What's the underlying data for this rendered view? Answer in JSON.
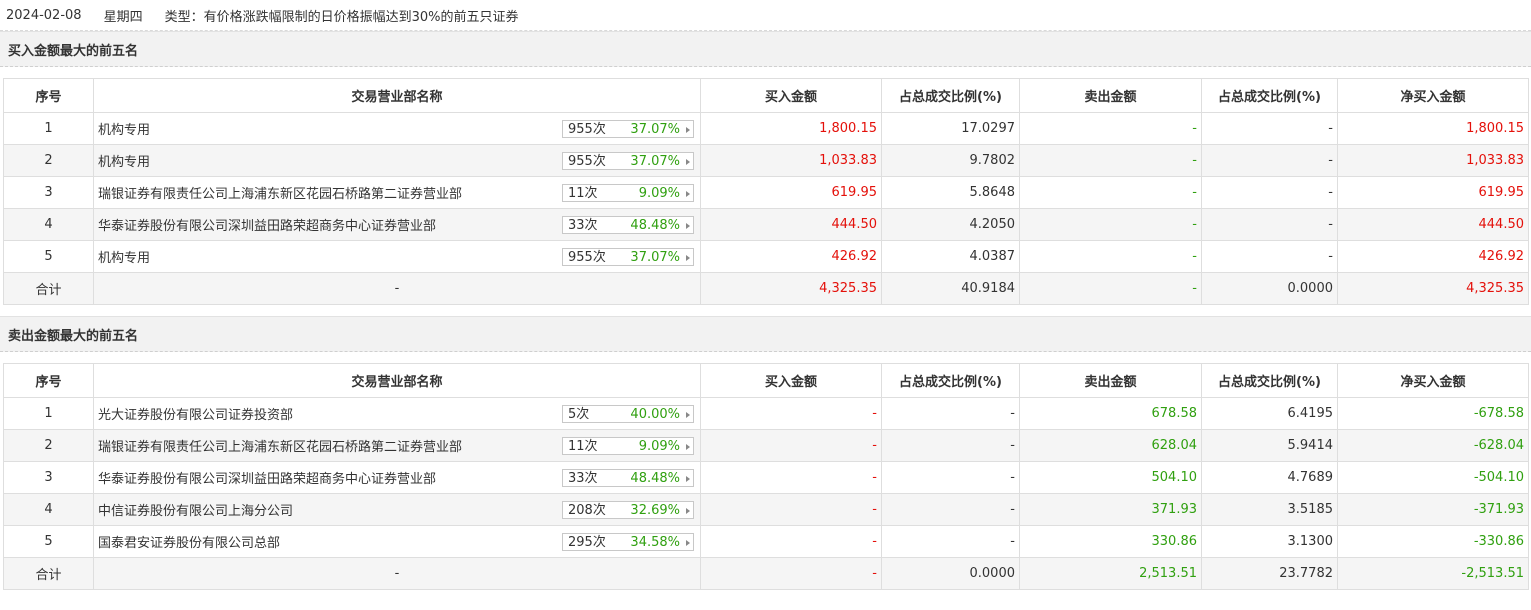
{
  "header": {
    "date": "2024-02-08",
    "weekday": "星期四",
    "type": "类型：有价格涨跌幅限制的日价格振幅达到30%的前五只证券"
  },
  "columns": [
    "序号",
    "交易营业部名称",
    "买入金额",
    "占总成交比例(%)",
    "卖出金额",
    "占总成交比例(%)",
    "净买入金额"
  ],
  "buy_section": {
    "title": "买入金额最大的前五名",
    "rows": [
      {
        "no": "1",
        "name": "机构专用",
        "times": "955次",
        "rate": "37.07%",
        "buy": "1,800.15",
        "buy_pct": "17.0297",
        "sell": "-",
        "sell_pct": "-",
        "net": "1,800.15"
      },
      {
        "no": "2",
        "name": "机构专用",
        "times": "955次",
        "rate": "37.07%",
        "buy": "1,033.83",
        "buy_pct": "9.7802",
        "sell": "-",
        "sell_pct": "-",
        "net": "1,033.83"
      },
      {
        "no": "3",
        "name": "瑞银证券有限责任公司上海浦东新区花园石桥路第二证券营业部",
        "times": "11次",
        "rate": "9.09%",
        "buy": "619.95",
        "buy_pct": "5.8648",
        "sell": "-",
        "sell_pct": "-",
        "net": "619.95"
      },
      {
        "no": "4",
        "name": "华泰证券股份有限公司深圳益田路荣超商务中心证券营业部",
        "times": "33次",
        "rate": "48.48%",
        "buy": "444.50",
        "buy_pct": "4.2050",
        "sell": "-",
        "sell_pct": "-",
        "net": "444.50"
      },
      {
        "no": "5",
        "name": "机构专用",
        "times": "955次",
        "rate": "37.07%",
        "buy": "426.92",
        "buy_pct": "4.0387",
        "sell": "-",
        "sell_pct": "-",
        "net": "426.92"
      }
    ],
    "total": {
      "label": "合计",
      "name": "-",
      "buy": "4,325.35",
      "buy_pct": "40.9184",
      "sell": "-",
      "sell_pct": "0.0000",
      "net": "4,325.35"
    }
  },
  "sell_section": {
    "title": "卖出金额最大的前五名",
    "rows": [
      {
        "no": "1",
        "name": "光大证券股份有限公司证券投资部",
        "times": "5次",
        "rate": "40.00%",
        "buy": "-",
        "buy_pct": "-",
        "sell": "678.58",
        "sell_pct": "6.4195",
        "net": "-678.58"
      },
      {
        "no": "2",
        "name": "瑞银证券有限责任公司上海浦东新区花园石桥路第二证券营业部",
        "times": "11次",
        "rate": "9.09%",
        "buy": "-",
        "buy_pct": "-",
        "sell": "628.04",
        "sell_pct": "5.9414",
        "net": "-628.04"
      },
      {
        "no": "3",
        "name": "华泰证券股份有限公司深圳益田路荣超商务中心证券营业部",
        "times": "33次",
        "rate": "48.48%",
        "buy": "-",
        "buy_pct": "-",
        "sell": "504.10",
        "sell_pct": "4.7689",
        "net": "-504.10"
      },
      {
        "no": "4",
        "name": "中信证券股份有限公司上海分公司",
        "times": "208次",
        "rate": "32.69%",
        "buy": "-",
        "buy_pct": "-",
        "sell": "371.93",
        "sell_pct": "3.5185",
        "net": "-371.93"
      },
      {
        "no": "5",
        "name": "国泰君安证券股份有限公司总部",
        "times": "295次",
        "rate": "34.58%",
        "buy": "-",
        "buy_pct": "-",
        "sell": "330.86",
        "sell_pct": "3.1300",
        "net": "-330.86"
      }
    ],
    "total": {
      "label": "合计",
      "name": "-",
      "buy": "-",
      "buy_pct": "0.0000",
      "sell": "2,513.51",
      "sell_pct": "23.7782",
      "net": "-2,513.51"
    }
  },
  "colors": {
    "buy": "#e4100a",
    "sell": "#30a010"
  }
}
